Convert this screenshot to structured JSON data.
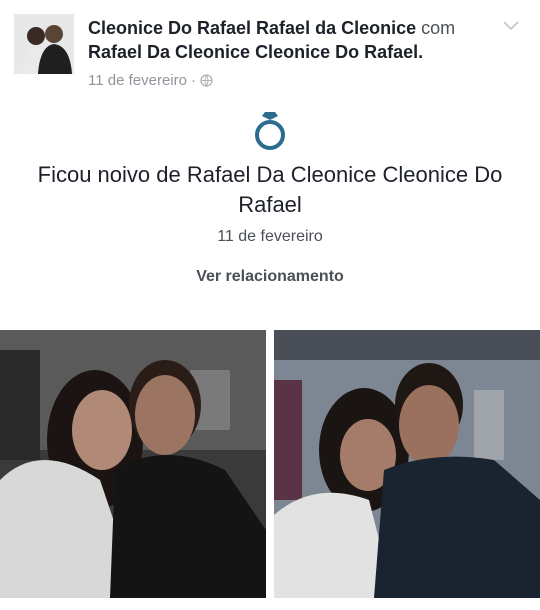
{
  "post": {
    "author": "Cleonice Do Rafael Rafael da Cleonice",
    "connector": "com",
    "tagged": "Rafael Da Cleonice Cleonice Do Rafael.",
    "date": "11 de fevereiro",
    "separator": "·",
    "privacy_icon": "globe-icon",
    "menu_icon": "chevron-down-icon"
  },
  "event": {
    "icon": "ring-icon",
    "title": "Ficou noivo de Rafael Da Cleonice Cleonice Do Rafael",
    "date": "11 de fevereiro",
    "link_label": "Ver relacionamento"
  },
  "photos": [
    {
      "name": "couple-photo-1"
    },
    {
      "name": "couple-photo-2"
    }
  ],
  "colors": {
    "text_primary": "#1d2129",
    "text_secondary": "#90949c",
    "link": "#4b4f56",
    "ring": "#2e6c8f"
  }
}
